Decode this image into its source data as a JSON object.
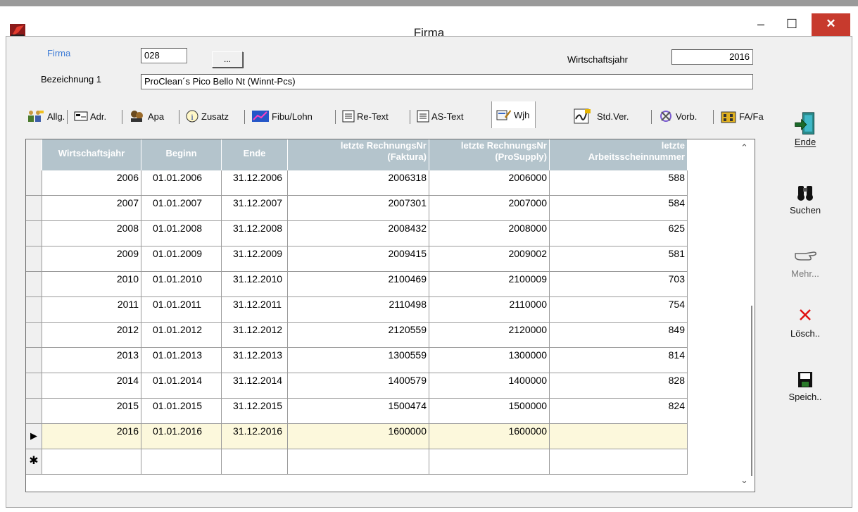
{
  "window": {
    "title": "Firma",
    "minimize_glyph": "–",
    "maximize_glyph": "☐",
    "close_glyph": "✕"
  },
  "header": {
    "firma_label": "Firma",
    "firma_value": "028",
    "lookup_button": "...",
    "wirtschaftsjahr_label": "Wirtschaftsjahr",
    "wirtschaftsjahr_value": "2016",
    "bezeichnung_label": "Bezeichnung 1",
    "bezeichnung_value": "ProClean´s Pico Bello Nt (Winnt-Pcs)"
  },
  "tabs": [
    {
      "label": "Allg.",
      "icon": "people-icon"
    },
    {
      "label": "Adr.",
      "icon": "address-card-icon"
    },
    {
      "label": "Apa",
      "icon": "contacts-icon"
    },
    {
      "label": "Zusatz",
      "icon": "info-icon"
    },
    {
      "label": "Fibu/Lohn",
      "icon": "chart-icon"
    },
    {
      "label": "Re-Text",
      "icon": "document-icon"
    },
    {
      "label": "AS-Text",
      "icon": "document-icon"
    },
    {
      "label": "Wjh",
      "icon": "edit-icon"
    },
    {
      "label": "Std.Ver.",
      "icon": "signature-icon"
    },
    {
      "label": "Vorb.",
      "icon": "tools-icon"
    },
    {
      "label": "FA/Fa",
      "icon": "building-icon"
    }
  ],
  "grid": {
    "columns": [
      {
        "line1": "Wirtschaftsjahr",
        "line2": ""
      },
      {
        "line1": "Beginn",
        "line2": ""
      },
      {
        "line1": "Ende",
        "line2": ""
      },
      {
        "line1": "letzte RechnungsNr",
        "line2": "(Faktura)"
      },
      {
        "line1": "letzte RechnungsNr",
        "line2": "(ProSupply)"
      },
      {
        "line1": "letzte",
        "line2": "Arbeitsscheinnummer"
      }
    ],
    "rows": [
      [
        "2006",
        "01.01.2006",
        "31.12.2006",
        "2006318",
        "2006000",
        "588"
      ],
      [
        "2007",
        "01.01.2007",
        "31.12.2007",
        "2007301",
        "2007000",
        "584"
      ],
      [
        "2008",
        "01.01.2008",
        "31.12.2008",
        "2008432",
        "2008000",
        "625"
      ],
      [
        "2009",
        "01.01.2009",
        "31.12.2009",
        "2009415",
        "2009002",
        "581"
      ],
      [
        "2010",
        "01.01.2010",
        "31.12.2010",
        "2100469",
        "2100009",
        "703"
      ],
      [
        "2011",
        "01.01.2011",
        "31.12.2011",
        "2110498",
        "2110000",
        "754"
      ],
      [
        "2012",
        "01.01.2012",
        "31.12.2012",
        "2120559",
        "2120000",
        "849"
      ],
      [
        "2013",
        "01.01.2013",
        "31.12.2013",
        "1300559",
        "1300000",
        "814"
      ],
      [
        "2014",
        "01.01.2014",
        "31.12.2014",
        "1400579",
        "1400000",
        "828"
      ],
      [
        "2015",
        "01.01.2015",
        "31.12.2015",
        "1500474",
        "1500000",
        "824"
      ],
      [
        "2016",
        "01.01.2016",
        "31.12.2016",
        "1600000",
        "1600000",
        ""
      ]
    ],
    "current_row_marker": "▶",
    "new_row_marker": "✱",
    "scroll_up": "⌃",
    "scroll_down": "⌄",
    "colors": {
      "header_bg": "#b4c4cc",
      "current_row_bg": "#fcf8dc"
    }
  },
  "toolbar": [
    {
      "label": "Ende",
      "icon": "exit-door-icon"
    },
    {
      "label": "Suchen",
      "icon": "binoculars-icon"
    },
    {
      "label": "Mehr...",
      "icon": "pointing-hand-icon"
    },
    {
      "label": "Lösch..",
      "icon": "delete-x-icon"
    },
    {
      "label": "Speich..",
      "icon": "floppy-disk-icon"
    }
  ]
}
